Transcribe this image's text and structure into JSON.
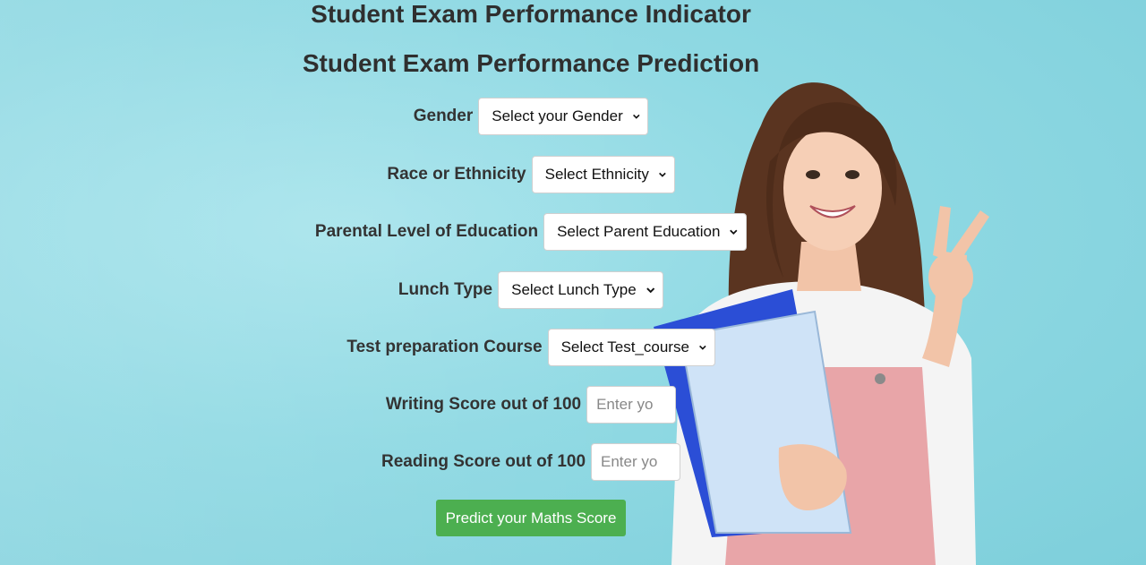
{
  "page": {
    "title": "Student Exam Performance Indicator",
    "subtitle": "Student Exam Performance Prediction"
  },
  "form": {
    "gender": {
      "label": "Gender",
      "selected": "Select your Gender"
    },
    "ethnicity": {
      "label": "Race or Ethnicity",
      "selected": "Select Ethnicity"
    },
    "parental_education": {
      "label": "Parental Level of Education",
      "selected": "Select Parent Education"
    },
    "lunch": {
      "label": "Lunch Type",
      "selected": "Select Lunch Type"
    },
    "test_course": {
      "label": "Test preparation Course",
      "selected": "Select Test_course"
    },
    "writing_score": {
      "label": "Writing Score out of 100",
      "placeholder": "Enter yo"
    },
    "reading_score": {
      "label": "Reading Score out of 100",
      "placeholder": "Enter yo"
    },
    "submit_label": "Predict your Maths Score"
  },
  "colors": {
    "background": "#8fd9e3",
    "button": "#4caf50",
    "heading": "#2f2f2f"
  },
  "icons": {
    "dropdown": "chevron-down-icon",
    "illustration": "student-holding-notebooks"
  }
}
